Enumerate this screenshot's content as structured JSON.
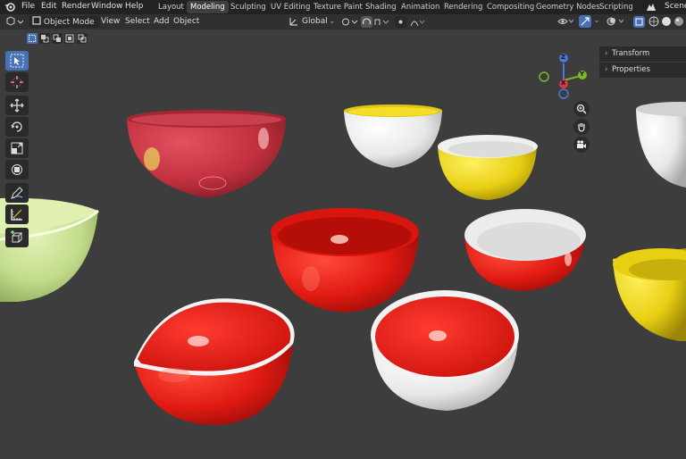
{
  "menubar": {
    "items": [
      "File",
      "Edit",
      "Render",
      "Window",
      "Help"
    ],
    "workspaces": [
      "Layout",
      "Modeling",
      "Sculpting",
      "UV Editing",
      "Texture Paint",
      "Shading",
      "Animation",
      "Rendering",
      "Compositing",
      "Geometry Nodes",
      "Scripting"
    ],
    "active_workspace": "Modeling",
    "scene_label": "Scene"
  },
  "header": {
    "mode": "Object Mode",
    "menus": [
      "View",
      "Select",
      "Add",
      "Object"
    ],
    "transform_orientation": "Global"
  },
  "side_panels": [
    "Transform",
    "Properties"
  ],
  "gizmo": {
    "z": "Z",
    "y": "Y",
    "x": "X"
  },
  "colors": {
    "accent": "#4772b3",
    "red": "#e21a1a",
    "yellow": "#e8cf12",
    "white": "#f2f2f2",
    "green": "#c3dc8c",
    "pink_red": "#c4344a"
  }
}
